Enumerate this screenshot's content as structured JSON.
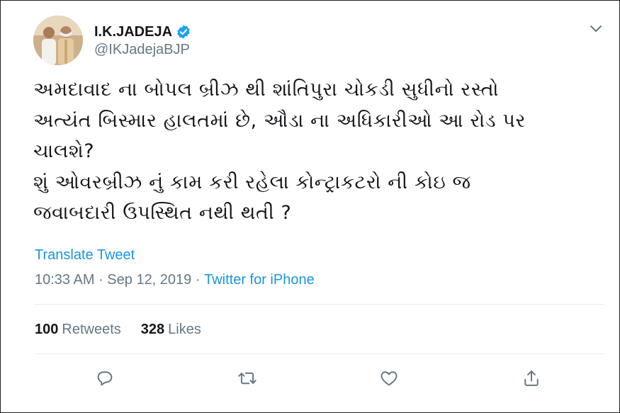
{
  "author": {
    "display_name": "I.K.JADEJA",
    "handle": "@IKJadejaBJP",
    "verified_icon": "verified-badge-icon",
    "avatar_icon": "profile-photo"
  },
  "tweet": {
    "text": "અમદાવાદ ના બોપલ બ્રીઝ થી શાંતિપુરા ચોકડી સુધીનો રસ્તો\nઅત્યંત બિસ્માર હાલતમાં છે, ઔડા ના અધિકારીઓ આ રોડ પર\nચાલશે?\nશું ઓવરબ્રીઝ નું કામ કરી રહેલા કોન્ટ્રાકટરો ની કોઇ જ\nજવાબદારી ઉપસ્થિત નથી થતી ?",
    "translate_label": "Translate Tweet",
    "time": "10:33 AM",
    "separator1": " · ",
    "date": "Sep 12, 2019",
    "separator2": " · ",
    "source": "Twitter for iPhone"
  },
  "stats": {
    "retweets_count": "100",
    "retweets_label": "Retweets",
    "likes_count": "328",
    "likes_label": "Likes"
  },
  "actions": [
    "reply-icon",
    "retweet-icon",
    "like-icon",
    "share-icon"
  ],
  "colors": {
    "link": "#1b95e0",
    "secondary_text": "#657786",
    "primary_text": "#14171a",
    "verified": "#1da1f2",
    "divider": "#e6ecf0"
  }
}
